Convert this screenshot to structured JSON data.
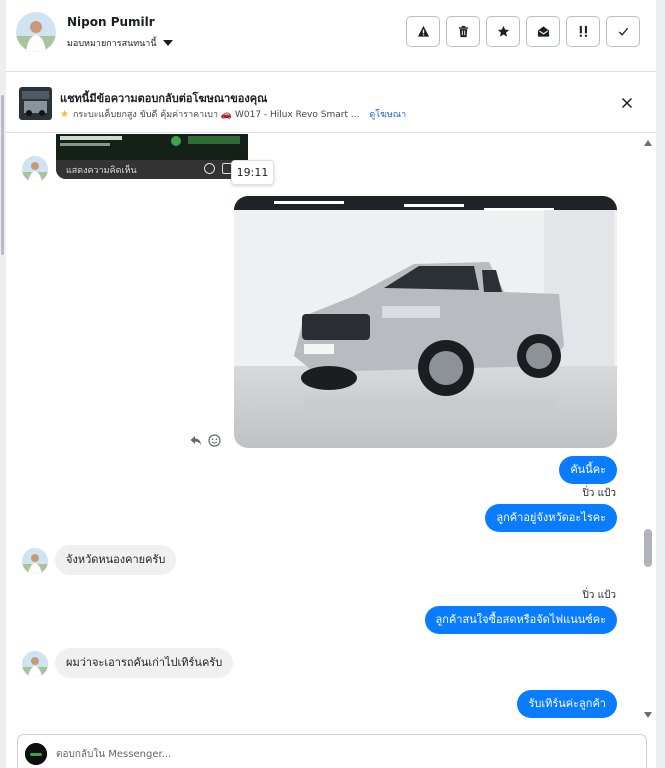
{
  "header": {
    "contact_name": "Nipon Pumilr",
    "assign_label": "มอบหมายการสนทนานี้",
    "actions": [
      {
        "name": "report-spam-button",
        "icon": "warning-icon"
      },
      {
        "name": "delete-button",
        "icon": "trash-icon"
      },
      {
        "name": "star-button",
        "icon": "star-icon"
      },
      {
        "name": "mark-unread-button",
        "icon": "envelope-open-icon"
      },
      {
        "name": "follow-up-button",
        "icon": "exclamation-icon"
      },
      {
        "name": "mark-done-button",
        "icon": "check-icon"
      }
    ]
  },
  "ad_banner": {
    "title": "แชทนี้มีข้อความตอบกลับต่อโฆษณาของคุณ",
    "subtitle": "กระบะแค็บยกสูง ขับดี คุ้มค่าราคาเบา 🚗 W017 - Hilux Revo Smart ...",
    "view_ad_label": "ดูโฆษณา"
  },
  "thread": {
    "shared_post_caption": "แสดงความคิดเห็น",
    "tooltip_time": "19:11",
    "messages": [
      {
        "direction": "out",
        "text": "คันนี้คะ"
      },
      {
        "direction": "out",
        "sender": "ปิ่ว แป้ว",
        "text": "ลูกค้าอยู่จังหวัดอะไรคะ"
      },
      {
        "direction": "in",
        "text": "จังหวัดหนองคายครับ"
      },
      {
        "direction": "out",
        "sender": "ปิ่ว แป้ว",
        "text": "ลูกค้าสนใจซื้อสดหรือจัดไฟแนนซ์คะ"
      },
      {
        "direction": "in",
        "text": "ผมว่าจะเอารถคันเก่าไปเทิร์นครับ"
      },
      {
        "direction": "out",
        "text": "รับเทิร์นค่ะลูกค้า"
      }
    ]
  },
  "composer": {
    "placeholder": "ตอบกลับใน Messenger..."
  },
  "colors": {
    "outgoing_bubble": "#0a7cff",
    "incoming_bubble": "#f0f0f0",
    "link": "#1763cf"
  }
}
